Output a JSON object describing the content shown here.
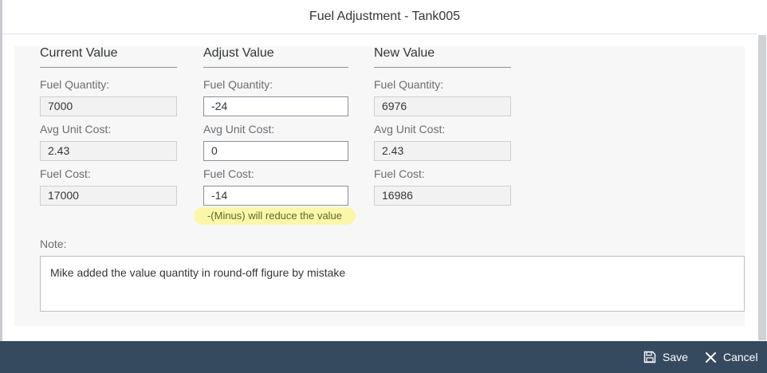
{
  "dialog": {
    "title": "Fuel Adjustment - Tank005"
  },
  "columns": [
    {
      "title": "Current Value",
      "fields": [
        {
          "label": "Fuel Quantity:",
          "value": "7000"
        },
        {
          "label": "Avg Unit Cost:",
          "value": "2.43"
        },
        {
          "label": "Fuel Cost:",
          "value": "17000"
        }
      ]
    },
    {
      "title": "Adjust Value",
      "fields": [
        {
          "label": "Fuel Quantity:",
          "value": "-24"
        },
        {
          "label": "Avg Unit Cost:",
          "value": "0"
        },
        {
          "label": "Fuel Cost:",
          "value": "-14"
        }
      ],
      "hint": "-(Minus) will reduce the value"
    },
    {
      "title": "New Value",
      "fields": [
        {
          "label": "Fuel Quantity:",
          "value": "6976"
        },
        {
          "label": "Avg Unit Cost:",
          "value": "2.43"
        },
        {
          "label": "Fuel Cost:",
          "value": "16986"
        }
      ]
    }
  ],
  "note": {
    "label": "Note:",
    "value": "Mike added the value quantity in round-off figure by mistake"
  },
  "footer": {
    "save_label": "Save",
    "cancel_label": "Cancel"
  },
  "icons": {
    "save": "save-icon",
    "cancel": "close-icon"
  },
  "colors": {
    "footer_bg": "#354a5f",
    "hint_highlight": "#fbf7a8"
  }
}
